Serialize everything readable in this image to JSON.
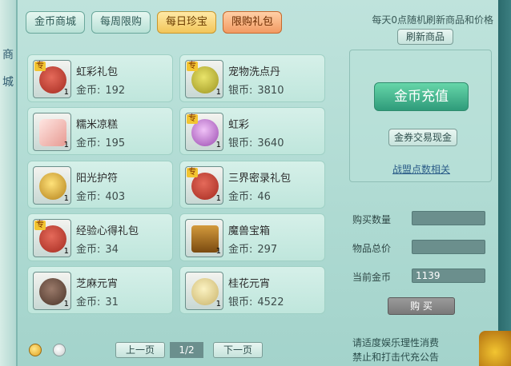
{
  "left_sidebar": {
    "chars": [
      "商",
      "城"
    ]
  },
  "tabs": [
    {
      "label": "金币商城"
    },
    {
      "label": "每周限购"
    },
    {
      "label": "每日珍宝"
    },
    {
      "label": "限购礼包"
    }
  ],
  "refresh": {
    "note": "每天0点随机刷新商品和价格",
    "button": "刷新商品"
  },
  "items": [
    {
      "name": "虹彩礼包",
      "currency": "金币:",
      "price": "192",
      "icon": "red-gift-bag-icon",
      "special": "专",
      "qty": "1",
      "color": "#c8463a"
    },
    {
      "name": "宠物洗点丹",
      "currency": "银币:",
      "price": "3810",
      "icon": "elixir-pills-icon",
      "special": "专",
      "qty": "1",
      "color": "#c9c23a"
    },
    {
      "name": "糯米凉糕",
      "currency": "金币:",
      "price": "195",
      "icon": "rice-cake-icon",
      "special": "",
      "qty": "1",
      "color": "#f3b7b1"
    },
    {
      "name": "虹彩",
      "currency": "银币:",
      "price": "3640",
      "icon": "perfume-bottle-icon",
      "special": "专",
      "qty": "1",
      "color": "#c77bd6"
    },
    {
      "name": "阳光护符",
      "currency": "金币:",
      "price": "403",
      "icon": "amulet-necklace-icon",
      "special": "",
      "qty": "1",
      "color": "#e1b23a"
    },
    {
      "name": "三界密录礼包",
      "currency": "金币:",
      "price": "46",
      "icon": "red-gift-bag-icon",
      "special": "专",
      "qty": "1",
      "color": "#c8463a"
    },
    {
      "name": "经验心得礼包",
      "currency": "金币:",
      "price": "34",
      "icon": "red-gift-bag-icon",
      "special": "专",
      "qty": "1",
      "color": "#c8463a"
    },
    {
      "name": "魔兽宝箱",
      "currency": "金币:",
      "price": "297",
      "icon": "treasure-chest-icon",
      "special": "",
      "qty": "1",
      "color": "#a86a1e"
    },
    {
      "name": "芝麻元宵",
      "currency": "金币:",
      "price": "31",
      "icon": "sesame-dumplings-icon",
      "special": "",
      "qty": "1",
      "color": "#6a4b3a"
    },
    {
      "name": "桂花元宵",
      "currency": "银币:",
      "price": "4522",
      "icon": "osmanthus-dumplings-icon",
      "special": "",
      "qty": "1",
      "color": "#e8d89a"
    }
  ],
  "right_panel": {
    "recharge": "金币充值",
    "voucher": "金券交易现金",
    "alliance": "战盟点数相关"
  },
  "purchase": {
    "qty_label": "购买数量",
    "qty_value": "",
    "total_label": "物品总价",
    "total_value": "",
    "current_label": "当前金币",
    "current_value": "1139",
    "buy": "购 买"
  },
  "pager": {
    "prev": "上一页",
    "indicator": "1/2",
    "next": "下一页"
  },
  "footer": {
    "line1": "请适度娱乐理性消费",
    "line2": "禁止和打击代充公告"
  }
}
